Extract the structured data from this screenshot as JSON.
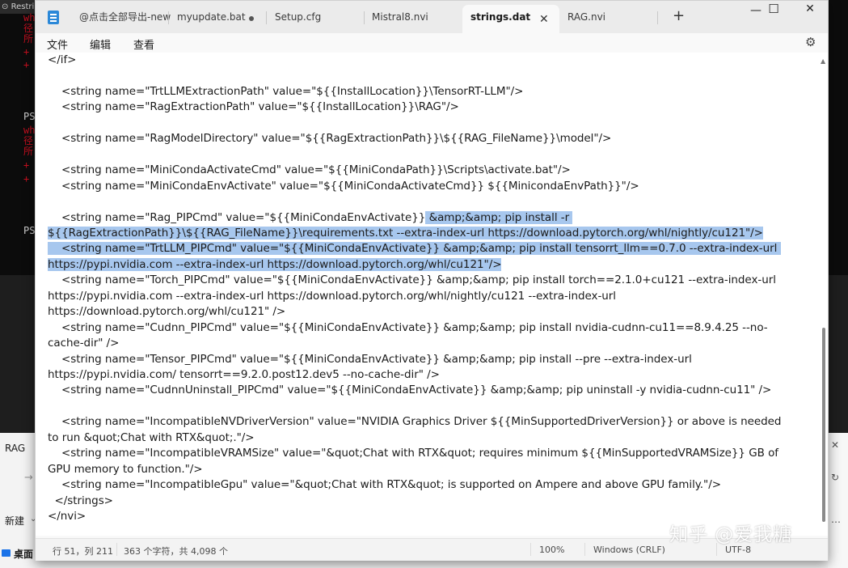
{
  "background": {
    "terminal": {
      "title": "Restri",
      "prompts": [
        "PS",
        "PS"
      ],
      "lines": [
        {
          "text": "wh",
          "color": "#c50f1f"
        },
        {
          "text": "径",
          "color": "#c50f1f"
        },
        {
          "text": "所",
          "color": "#c50f1f"
        },
        {
          "text": "+",
          "color": "#c50f1f"
        },
        {
          "text": "+",
          "color": "#c50f1f"
        },
        {
          "text": "wh",
          "color": "#c50f1f"
        },
        {
          "text": "径",
          "color": "#c50f1f"
        },
        {
          "text": "所",
          "color": "#c50f1f"
        },
        {
          "text": "+",
          "color": "#c50f1f"
        },
        {
          "text": "+",
          "color": "#c50f1f"
        }
      ]
    },
    "explorer": {
      "title": "RAG",
      "new_label": "新建",
      "desktop_label": "桌面"
    }
  },
  "notepad": {
    "tabs": [
      {
        "label": "@点击全部导出-new"
      },
      {
        "label": "myupdate.bat"
      },
      {
        "label": "Setup.cfg"
      },
      {
        "label": "Mistral8.nvi"
      },
      {
        "label": "strings.dat",
        "active": true
      },
      {
        "label": "RAG.nvi"
      }
    ],
    "window_controls": {
      "minimize": "—",
      "maximize": "☐",
      "close": "✕"
    },
    "menu": [
      "文件",
      "编辑",
      "查看"
    ],
    "lines": [
      {
        "text": "</if>"
      },
      {
        "text": ""
      },
      {
        "text": "    <string name=\"TrtLLMExtractionPath\" value=\"${{InstallLocation}}\\TensorRT-LLM\"/>"
      },
      {
        "text": "    <string name=\"RagExtractionPath\" value=\"${{InstallLocation}}\\RAG\"/>"
      },
      {
        "text": ""
      },
      {
        "text": "    <string name=\"RagModelDirectory\" value=\"${{RagExtractionPath}}\\${{RAG_FileName}}\\model\"/>"
      },
      {
        "text": ""
      },
      {
        "text": "    <string name=\"MiniCondaActivateCmd\" value=\"${{MiniCondaPath}}\\Scripts\\activate.bat\"/>"
      },
      {
        "text": "    <string name=\"MiniCondaEnvActivate\" value=\"${{MiniCondaActivateCmd}} ${{MinicondaEnvPath}}\"/>"
      },
      {
        "text": ""
      },
      {
        "text": "    <string name=\"Rag_PIPCmd\" value=\"${{MiniCondaEnvActivate}}",
        "hl": " &amp;&amp; pip install -r "
      },
      {
        "text": "",
        "hl": "${{RagExtractionPath}}\\${{RAG_FileName}}\\requirements.txt --extra-index-url https://download.pytorch.org/whl/nightly/cu121\"/>"
      },
      {
        "text": "",
        "hl": "    <string name=\"TrtLLM_PIPCmd\" value=\"${{MiniCondaEnvActivate}} &amp;&amp; pip install tensorrt_llm==0.7.0 --extra-index-url "
      },
      {
        "text": "",
        "hl": "https://pypi.nvidia.com --extra-index-url https://download.pytorch.org/whl/cu121\"/>"
      },
      {
        "text": "    <string name=\"Torch_PIPCmd\" value=\"${{MiniCondaEnvActivate}} &amp;&amp; pip install torch==2.1.0+cu121 --extra-index-url"
      },
      {
        "text": "https://pypi.nvidia.com --extra-index-url https://download.pytorch.org/whl/nightly/cu121 --extra-index-url"
      },
      {
        "text": "https://download.pytorch.org/whl/cu121\" />"
      },
      {
        "text": "    <string name=\"Cudnn_PIPCmd\" value=\"${{MiniCondaEnvActivate}} &amp;&amp; pip install nvidia-cudnn-cu11==8.9.4.25 --no-"
      },
      {
        "text": "cache-dir\" />"
      },
      {
        "text": "    <string name=\"Tensor_PIPCmd\" value=\"${{MiniCondaEnvActivate}} &amp;&amp; pip install --pre --extra-index-url"
      },
      {
        "text": "https://pypi.nvidia.com/ tensorrt==9.2.0.post12.dev5 --no-cache-dir\" />"
      },
      {
        "text": "    <string name=\"CudnnUninstall_PIPCmd\" value=\"${{MiniCondaEnvActivate}} &amp;&amp; pip uninstall -y nvidia-cudnn-cu11\" />"
      },
      {
        "text": ""
      },
      {
        "text": "    <string name=\"IncompatibleNVDriverVersion\" value=\"NVIDIA Graphics Driver ${{MinSupportedDriverVersion}} or above is needed"
      },
      {
        "text": "to run &quot;Chat with RTX&quot;.\"/>"
      },
      {
        "text": "    <string name=\"IncompatibleVRAMSize\" value=\"&quot;Chat with RTX&quot; requires minimum ${{MinSupportedVRAMSize}} GB of"
      },
      {
        "text": "GPU memory to function.\"/>"
      },
      {
        "text": "    <string name=\"IncompatibleGpu\" value=\"&quot;Chat with RTX&quot; is supported on Ampere and above GPU family.\"/>"
      },
      {
        "text": "  </strings>"
      },
      {
        "text": "</nvi>"
      }
    ],
    "status": {
      "position": "行 51，列 211",
      "chars": "363 个字符，共 4,098 个",
      "zoom": "100%",
      "line_ending": "Windows (CRLF)",
      "encoding": "UTF-8"
    }
  },
  "watermark": "知乎 @爱我糖"
}
